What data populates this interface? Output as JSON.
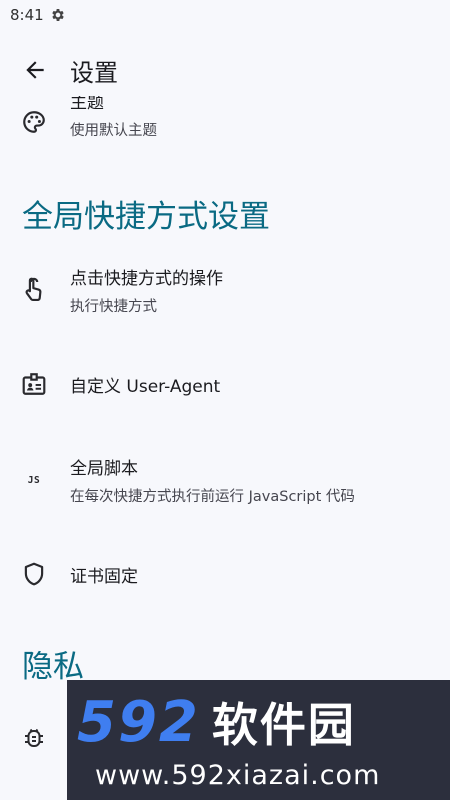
{
  "status": {
    "time": "8:41"
  },
  "app_bar": {
    "title": "设置"
  },
  "rows": {
    "theme": {
      "title": "主题",
      "summary": "使用默认主题"
    },
    "click_action": {
      "title": "点击快捷方式的操作",
      "summary": "执行快捷方式"
    },
    "user_agent": {
      "title": "自定义 User-Agent"
    },
    "global_script": {
      "title": "全局脚本",
      "summary": "在每次快捷方式执行前运行 JavaScript 代码",
      "icon_text": "JS"
    },
    "cert_pinning": {
      "title": "证书固定"
    }
  },
  "sections": {
    "global_shortcut": "全局快捷方式设置",
    "privacy": "隐私"
  },
  "watermark": {
    "number": "592",
    "name": "软件园",
    "url": "www.592xiazai.com"
  },
  "icons": [
    "back-arrow-icon",
    "gear-icon",
    "palette-icon",
    "touch-icon",
    "badge-icon",
    "js-icon",
    "shield-icon",
    "bug-icon"
  ],
  "colors": {
    "accent": "#0a6a83",
    "background": "#f7f8fc",
    "watermark_blue": "#3f7ef0"
  }
}
